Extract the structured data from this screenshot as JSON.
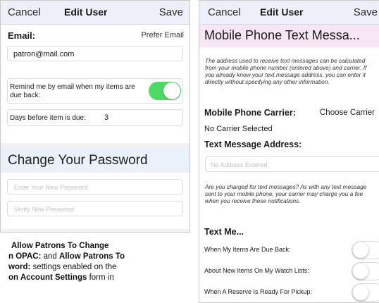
{
  "left": {
    "nav": {
      "cancel": "Cancel",
      "title": "Edit User",
      "save": "Save"
    },
    "email_label": "Email:",
    "prefer_email": "Prefer Email",
    "email_value": "patron@mail.com",
    "remind_label": "Remind me by email when my items are due back:",
    "remind_on": true,
    "days_label": "Days before item is due:",
    "days_value": "3",
    "change_password_heading": "Change Your Password",
    "new_password_placeholder": "Enter Your New Password",
    "verify_password_placeholder": "Verify New Password"
  },
  "caption": {
    "line1_bold": "Allow Patrons To Change",
    "line2_bold_a": "n OPAC:",
    "line2_text": " and ",
    "line2_bold_b": "Allow Patrons To",
    "line3_bold": "word:",
    "line3_text": " settings enabled on the",
    "line4_bold": "on Account Settings",
    "line4_text": " form in"
  },
  "right": {
    "nav": {
      "cancel": "Cancel",
      "title": "Edit User",
      "save": "Save"
    },
    "heading": "Mobile Phone Text Messa...",
    "intro_text": "The address used to receive text messages can be calculated from your mobile phone number (entered above) and carrier.  If you already know your text message address, you can enter it directly without specifying any other information.",
    "carrier_label": "Mobile Phone Carrier:",
    "choose_carrier": "Choose Carrier",
    "no_carrier": "No Carrier Selected",
    "text_address_label": "Text Message Address:",
    "no_address_placeholder": "No Address Entered",
    "charge_text": "Are you charged for text messages? As with any text message sent to your mobile phone, your carrier may charge you a fee when you receive these notifications.",
    "text_me_label": "Text Me...",
    "options": [
      {
        "label": "When My Items Are Due Back:",
        "on": false
      },
      {
        "label": "About New Items On My Watch Lists:",
        "on": false
      },
      {
        "label": "When A Reserve Is Ready For Pickup:",
        "on": false
      }
    ]
  },
  "colors": {
    "toggle_on": "#4cd964",
    "heading_band": "#eaf1fb",
    "right_heading_band": "#f7e6f3"
  }
}
